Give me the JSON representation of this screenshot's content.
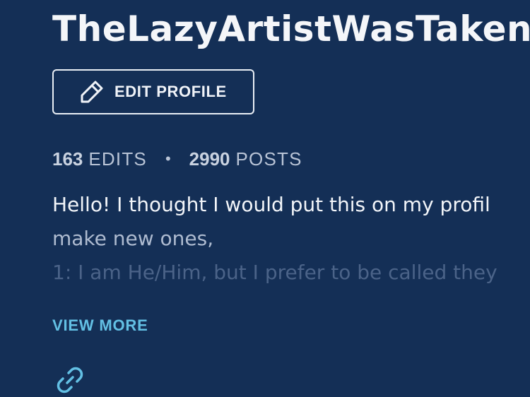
{
  "profile": {
    "username": "TheLazyArtistWasTaken",
    "edit_button_label": "EDIT PROFILE",
    "stats": {
      "edits_count": "163",
      "edits_label": "EDITS",
      "separator": "•",
      "posts_count": "2990",
      "posts_label": "POSTS"
    },
    "bio": {
      "line1": "Hello! I thought I would put this on my profil",
      "line2": "make new ones,",
      "line3": "1: I am He/Him, but I prefer to be called they"
    },
    "view_more_label": "VIEW MORE",
    "icons": {
      "edit": "pencil-icon",
      "link": "link-icon"
    }
  },
  "colors": {
    "background": "#142f56",
    "accent": "#63c0e4",
    "text": "#f2f5f9",
    "muted": "#b9c4d6"
  }
}
